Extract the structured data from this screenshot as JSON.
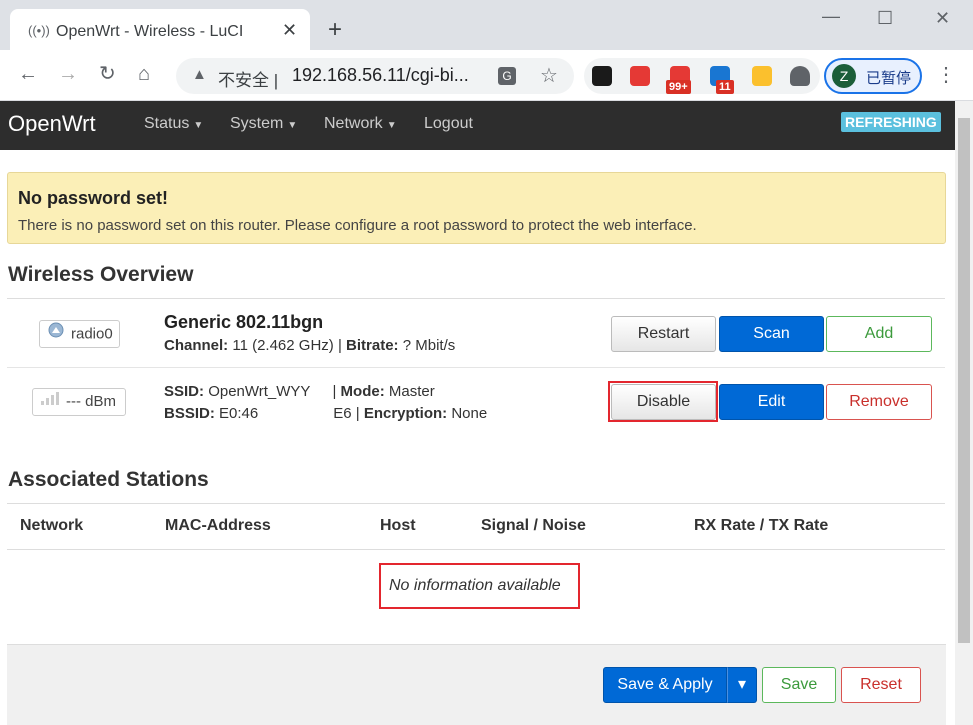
{
  "browser": {
    "tab_title": "OpenWrt - Wireless - LuCI",
    "tab_close": "✕",
    "new_tab": "+",
    "window_minimize": "—",
    "window_maximize": "☐",
    "window_close": "✕",
    "back": "←",
    "forward": "→",
    "reload": "↻",
    "home": "⌂",
    "security_warning": "▲",
    "insecure_label": "不安全 |",
    "url": "192.168.56.11/cgi-bi...",
    "translate": "G",
    "bookmark": "☆",
    "extensions": [
      {
        "icon": "tampermonkey-icon",
        "color": "#1a1a1a"
      },
      {
        "icon": "bilibili-icon",
        "color": "#e53935"
      },
      {
        "icon": "read-later-icon",
        "color": "#e53935",
        "badge": "99+"
      },
      {
        "icon": "apps-icon",
        "color": "#1976d2",
        "badge": "11"
      },
      {
        "icon": "download-icon",
        "color": "#fbc02d"
      },
      {
        "icon": "puzzle-icon",
        "color": "#5f6368"
      }
    ],
    "profile_initial": "Z",
    "profile_status": "已暂停",
    "menu": "⋮"
  },
  "navbar": {
    "brand": "OpenWrt",
    "menus": [
      "Status",
      "System",
      "Network",
      "Logout"
    ],
    "refreshing": "REFRESHING"
  },
  "alert": {
    "title": "No password set!",
    "text": "There is no password set on this router. Please configure a root password to protect the web interface."
  },
  "wireless": {
    "heading": "Wireless Overview",
    "radio": {
      "badge": "radio0",
      "title": "Generic 802.11bgn",
      "channel_label": "Channel:",
      "channel_value": "11 (2.462 GHz)",
      "sep": "|",
      "bitrate_label": "Bitrate:",
      "bitrate_value": "? Mbit/s",
      "buttons": {
        "restart": "Restart",
        "scan": "Scan",
        "add": "Add"
      }
    },
    "network": {
      "badge": "--- dBm",
      "ssid_label": "SSID:",
      "ssid_value": "OpenWrt_WYY",
      "mode_label": "Mode:",
      "mode_value": "Master",
      "bssid_label": "BSSID:",
      "bssid_prefix": "E0:46",
      "bssid_suffix": "E6",
      "encryption_label": "Encryption:",
      "encryption_value": "None",
      "buttons": {
        "disable": "Disable",
        "edit": "Edit",
        "remove": "Remove"
      }
    }
  },
  "stations": {
    "heading": "Associated Stations",
    "columns": [
      "Network",
      "MAC-Address",
      "Host",
      "Signal / Noise",
      "RX Rate / TX Rate"
    ],
    "empty": "No information available"
  },
  "footer": {
    "save_apply": "Save & Apply",
    "dropdown": "▾",
    "save": "Save",
    "reset": "Reset"
  },
  "colors": {
    "accent": "#0069d6",
    "highlight": "#e3262e",
    "alert_bg": "#fbefb7",
    "navbar_bg": "#2d2d2d"
  }
}
